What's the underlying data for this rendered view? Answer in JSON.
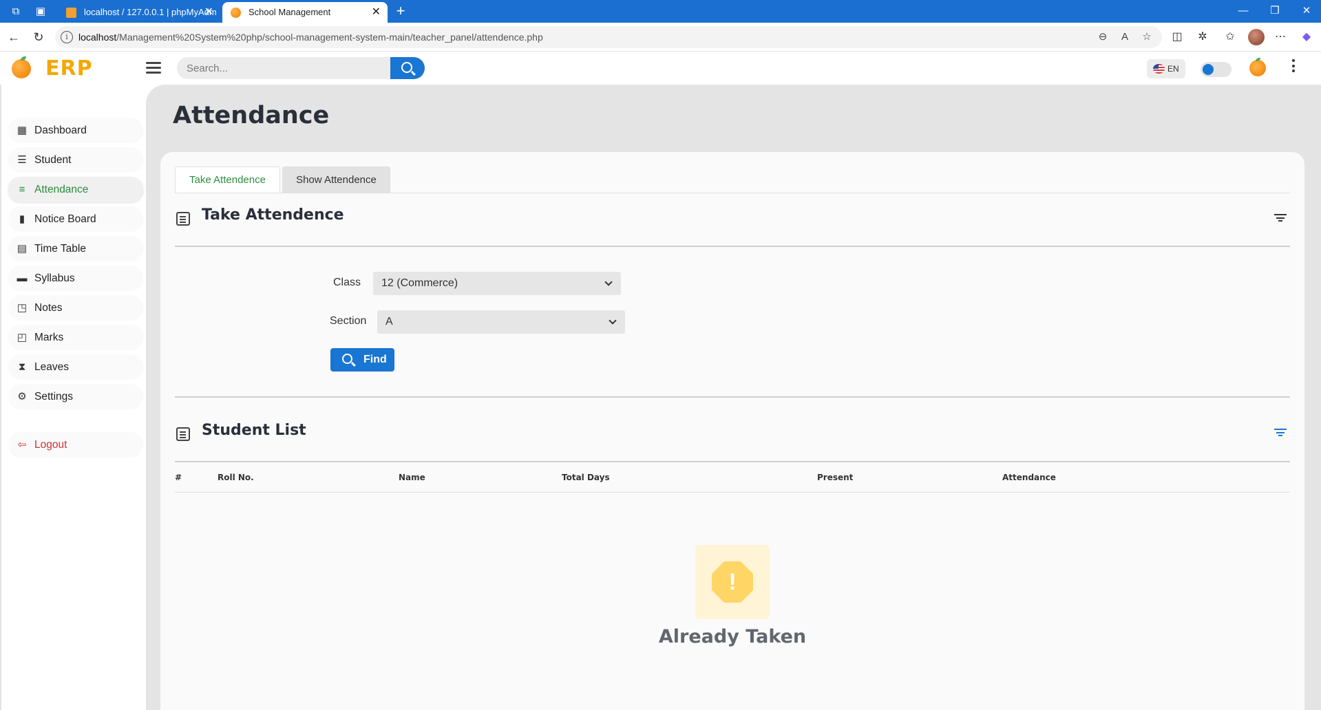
{
  "browser": {
    "tabs": [
      {
        "title": "localhost / 127.0.0.1 | phpMyAdm",
        "active": false
      },
      {
        "title": "School Management",
        "active": true
      }
    ],
    "url_host": "localhost",
    "url_path": "/Management%20System%20php/school-management-system-main/teacher_panel/attendence.php"
  },
  "header": {
    "logo": "ERP",
    "search_placeholder": "Search...",
    "language": "EN"
  },
  "sidebar": {
    "items": [
      {
        "label": "Dashboard",
        "icon": "dashboard-icon"
      },
      {
        "label": "Student",
        "icon": "student-icon"
      },
      {
        "label": "Attendance",
        "icon": "attendance-icon",
        "active": true
      },
      {
        "label": "Notice Board",
        "icon": "bookmark-icon"
      },
      {
        "label": "Time Table",
        "icon": "table-icon"
      },
      {
        "label": "Syllabus",
        "icon": "document-icon"
      },
      {
        "label": "Notes",
        "icon": "note-icon"
      },
      {
        "label": "Marks",
        "icon": "marks-icon"
      },
      {
        "label": "Leaves",
        "icon": "hourglass-icon"
      },
      {
        "label": "Settings",
        "icon": "gear-icon"
      }
    ],
    "logout": "Logout"
  },
  "main": {
    "title": "Attendance",
    "tabs": [
      "Take Attendence",
      "Show Attendence"
    ],
    "take_section_title": "Take Attendence",
    "form": {
      "class_label": "Class",
      "class_value": "12 (Commerce)",
      "section_label": "Section",
      "section_value": "A",
      "find_label": "Find"
    },
    "list_section_title": "Student List",
    "columns": [
      "#",
      "Roll No.",
      "Name",
      "Total Days",
      "Present",
      "Attendance"
    ],
    "empty_message": "Already Taken"
  },
  "colors": {
    "accent": "#1976d2",
    "active_green": "#2e8b3e",
    "logout_red": "#d32f2f",
    "logo_orange": "#f5a700",
    "tabbar_blue": "#1a6fd0"
  }
}
